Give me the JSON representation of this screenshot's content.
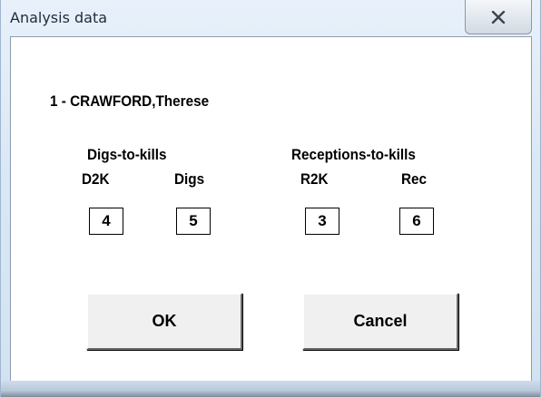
{
  "window": {
    "title": "Analysis data",
    "close_icon": "close-x-icon"
  },
  "player": {
    "label": "1  - CRAWFORD,Therese"
  },
  "groups": {
    "digs_to_kills": {
      "heading": "Digs-to-kills",
      "d2k_label": "D2K",
      "d2k_value": "4",
      "digs_label": "Digs",
      "digs_value": "5"
    },
    "receptions_to_kills": {
      "heading": "Receptions-to-kills",
      "r2k_label": "R2K",
      "r2k_value": "3",
      "rec_label": "Rec",
      "rec_value": "6"
    }
  },
  "buttons": {
    "ok_label": "OK",
    "cancel_label": "Cancel"
  }
}
